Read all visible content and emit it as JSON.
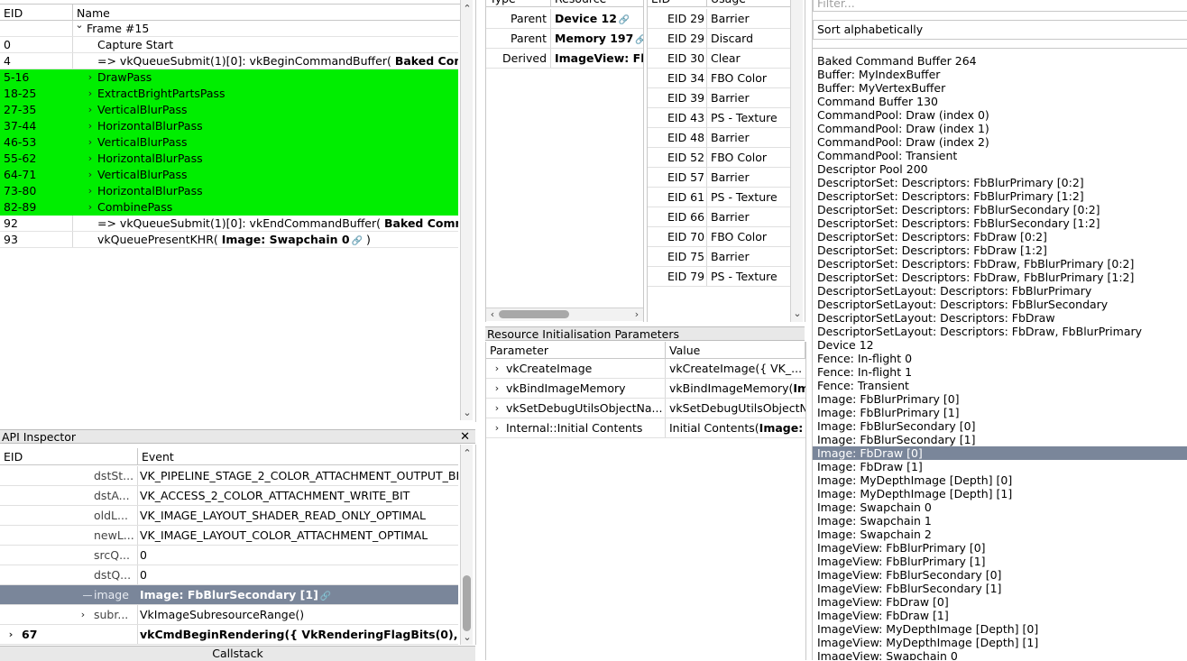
{
  "event_browser": {
    "columns": [
      "EID",
      "Name"
    ],
    "rows": [
      {
        "eid": "",
        "name": "Frame #15",
        "bold": ""
      },
      {
        "eid": "0",
        "name": "Capture Start",
        "bold": ""
      },
      {
        "eid": "4",
        "name": "=> vkQueueSubmit(1)[0]: vkBeginCommandBuffer(",
        "bold": "Baked Comm"
      },
      {
        "eid": "5-16",
        "name": "DrawPass",
        "bold": ""
      },
      {
        "eid": "18-25",
        "name": "ExtractBrightPartsPass",
        "bold": ""
      },
      {
        "eid": "27-35",
        "name": "VerticalBlurPass",
        "bold": ""
      },
      {
        "eid": "37-44",
        "name": "HorizontalBlurPass",
        "bold": ""
      },
      {
        "eid": "46-53",
        "name": "VerticalBlurPass",
        "bold": ""
      },
      {
        "eid": "55-62",
        "name": "HorizontalBlurPass",
        "bold": ""
      },
      {
        "eid": "64-71",
        "name": "VerticalBlurPass",
        "bold": ""
      },
      {
        "eid": "73-80",
        "name": "HorizontalBlurPass",
        "bold": ""
      },
      {
        "eid": "82-89",
        "name": "CombinePass",
        "bold": ""
      },
      {
        "eid": "92",
        "name": "=> vkQueueSubmit(1)[0]: vkEndCommandBuffer(",
        "bold": "Baked Comma"
      },
      {
        "eid": "93",
        "name": "vkQueuePresentKHR(",
        "bold": "Image: Swapchain 0",
        "suffix": " )"
      }
    ]
  },
  "api_inspector": {
    "title": "API Inspector",
    "columns": [
      "EID",
      "Event"
    ],
    "rows": [
      {
        "eid": "dstSt...",
        "event": "VK_PIPELINE_STAGE_2_COLOR_ATTACHMENT_OUTPUT_BIT"
      },
      {
        "eid": "dstA...",
        "event": "VK_ACCESS_2_COLOR_ATTACHMENT_WRITE_BIT"
      },
      {
        "eid": "oldL...",
        "event": "VK_IMAGE_LAYOUT_SHADER_READ_ONLY_OPTIMAL"
      },
      {
        "eid": "newL...",
        "event": "VK_IMAGE_LAYOUT_COLOR_ATTACHMENT_OPTIMAL"
      },
      {
        "eid": "srcQ...",
        "event": "0"
      },
      {
        "eid": "dstQ...",
        "event": "0"
      },
      {
        "eid": "image",
        "event": "Image: FbBlurSecondary [1]"
      },
      {
        "eid": "subr...",
        "event": "VkImageSubresourceRange()"
      },
      {
        "eid": "67",
        "event": "vkCmdBeginRendering({ VkRenderingFlagBits(0),..."
      }
    ],
    "footer": "Callstack"
  },
  "related": {
    "columns": [
      "Type",
      "Resource"
    ],
    "rows": [
      {
        "type": "Parent",
        "resource": "Device 12"
      },
      {
        "type": "Parent",
        "resource": "Memory 197"
      },
      {
        "type": "Derived",
        "resource": "ImageView: Fb"
      }
    ]
  },
  "usage": {
    "columns": [
      "EID",
      "Usage"
    ],
    "rows": [
      {
        "eid": "EID 29",
        "usage": "Barrier"
      },
      {
        "eid": "EID 29",
        "usage": "Discard"
      },
      {
        "eid": "EID 30",
        "usage": "Clear"
      },
      {
        "eid": "EID 34",
        "usage": "FBO Color"
      },
      {
        "eid": "EID 39",
        "usage": "Barrier"
      },
      {
        "eid": "EID 43",
        "usage": "PS - Texture"
      },
      {
        "eid": "EID 48",
        "usage": "Barrier"
      },
      {
        "eid": "EID 52",
        "usage": "FBO Color"
      },
      {
        "eid": "EID 57",
        "usage": "Barrier"
      },
      {
        "eid": "EID 61",
        "usage": "PS - Texture"
      },
      {
        "eid": "EID 66",
        "usage": "Barrier"
      },
      {
        "eid": "EID 70",
        "usage": "FBO Color"
      },
      {
        "eid": "EID 75",
        "usage": "Barrier"
      },
      {
        "eid": "EID 79",
        "usage": "PS - Texture"
      }
    ]
  },
  "init_params": {
    "title": "Resource Initialisation Parameters",
    "columns": [
      "Parameter",
      "Value"
    ],
    "rows": [
      {
        "param": "vkCreateImage",
        "value": "vkCreateImage({ VK_...",
        "bold": ""
      },
      {
        "param": "vkBindImageMemory",
        "value": "vkBindImageMemory(",
        "bold": "Im"
      },
      {
        "param": "vkSetDebugUtilsObjectNa...",
        "value": "vkSetDebugUtilsObjectNa",
        "bold": ""
      },
      {
        "param": "Internal::Initial Contents",
        "value": "Initial Contents(",
        "bold": "Image:"
      }
    ]
  },
  "resource_list": {
    "filter_placeholder": "Filter...",
    "sort_label": "Sort alphabetically",
    "selected_index": 29,
    "items": [
      "Baked Command Buffer 264",
      "Buffer: MyIndexBuffer",
      "Buffer: MyVertexBuffer",
      "Command Buffer 130",
      "CommandPool: Draw (index 0)",
      "CommandPool: Draw (index 1)",
      "CommandPool: Draw (index 2)",
      "CommandPool: Transient",
      "Descriptor Pool 200",
      "DescriptorSet: Descriptors: FbBlurPrimary [0:2]",
      "DescriptorSet: Descriptors: FbBlurPrimary [1:2]",
      "DescriptorSet: Descriptors: FbBlurSecondary [0:2]",
      "DescriptorSet: Descriptors: FbBlurSecondary [1:2]",
      "DescriptorSet: Descriptors: FbDraw [0:2]",
      "DescriptorSet: Descriptors: FbDraw [1:2]",
      "DescriptorSet: Descriptors: FbDraw, FbBlurPrimary [0:2]",
      "DescriptorSet: Descriptors: FbDraw, FbBlurPrimary [1:2]",
      "DescriptorSetLayout: Descriptors: FbBlurPrimary",
      "DescriptorSetLayout: Descriptors: FbBlurSecondary",
      "DescriptorSetLayout: Descriptors: FbDraw",
      "DescriptorSetLayout: Descriptors: FbDraw, FbBlurPrimary",
      "Device 12",
      "Fence: In-flight 0",
      "Fence: In-flight 1",
      "Fence: Transient",
      "Image: FbBlurPrimary [0]",
      "Image: FbBlurPrimary [1]",
      "Image: FbBlurSecondary [0]",
      "Image: FbBlurSecondary [1]",
      "Image: FbDraw [0]",
      "Image: FbDraw [1]",
      "Image: MyDepthImage [Depth] [0]",
      "Image: MyDepthImage [Depth] [1]",
      "Image: Swapchain 0",
      "Image: Swapchain 1",
      "Image: Swapchain 2",
      "ImageView: FbBlurPrimary [0]",
      "ImageView: FbBlurPrimary [1]",
      "ImageView: FbBlurSecondary [0]",
      "ImageView: FbBlurSecondary [1]",
      "ImageView: FbDraw [0]",
      "ImageView: FbDraw [1]",
      "ImageView: MyDepthImage [Depth] [0]",
      "ImageView: MyDepthImage [Depth] [1]",
      "ImageView: Swapchain 0"
    ]
  },
  "colors": {
    "pass_highlight": "#00ee00",
    "selection": "#7a869a"
  }
}
